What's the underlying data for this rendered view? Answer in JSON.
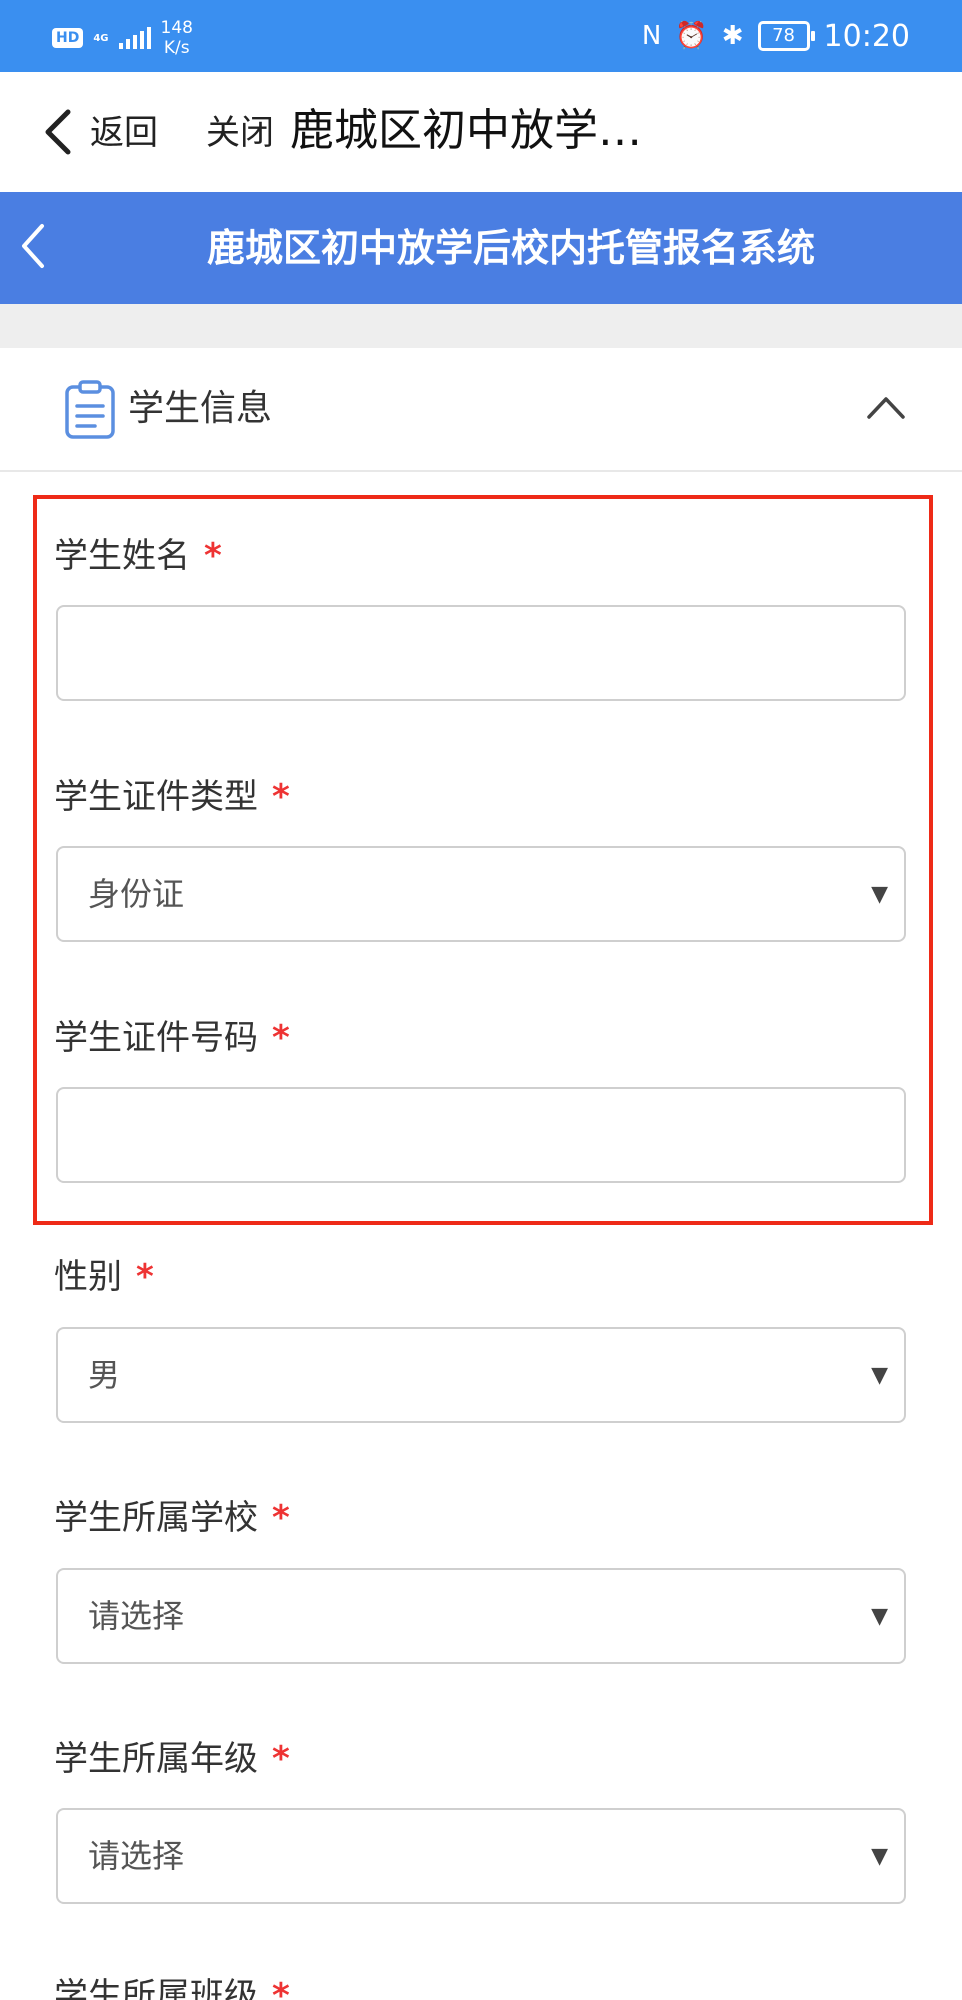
{
  "status_bar": {
    "hd": "HD",
    "network": "4G",
    "speed_value": "148",
    "speed_unit": "K/s",
    "battery": "78",
    "time": "10:20",
    "icons": [
      "nfc-icon",
      "alarm-icon",
      "bluetooth-icon"
    ]
  },
  "nav": {
    "back_label": "返回",
    "close_label": "关闭",
    "title": "鹿城区初中放学…"
  },
  "app_header": {
    "title": "鹿城区初中放学后校内托管报名系统"
  },
  "section": {
    "title": "学生信息"
  },
  "fields": {
    "name": {
      "label": "学生姓名",
      "required": "*",
      "value": ""
    },
    "id_type": {
      "label": "学生证件类型",
      "required": "*",
      "value": "身份证"
    },
    "id_number": {
      "label": "学生证件号码",
      "required": "*",
      "value": ""
    },
    "gender": {
      "label": "性别",
      "required": "*",
      "value": "男"
    },
    "school": {
      "label": "学生所属学校",
      "required": "*",
      "value": "请选择"
    },
    "grade": {
      "label": "学生所属年级",
      "required": "*",
      "value": "请选择"
    },
    "class": {
      "label": "学生所属班级",
      "required": "*"
    }
  },
  "select_arrow": "▼",
  "colors": {
    "status_bar": "#3a8ff0",
    "app_header": "#4a7ee2",
    "highlight": "#ee2a17",
    "required": "#e33333"
  }
}
